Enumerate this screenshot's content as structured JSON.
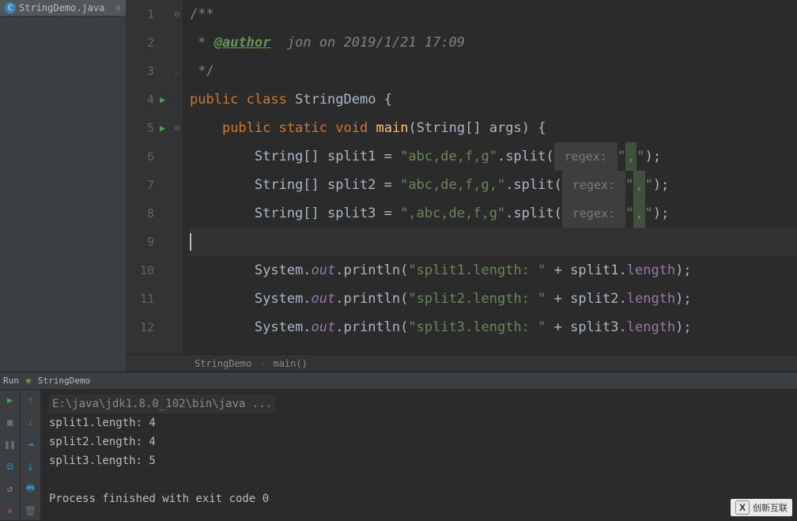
{
  "tab": {
    "filename": "StringDemo.java"
  },
  "gutter": {
    "lines": [
      "1",
      "2",
      "3",
      "4",
      "5",
      "6",
      "7",
      "8",
      "9",
      "10",
      "11",
      "12"
    ]
  },
  "code": {
    "l1_open": "/**",
    "l2_star": " *",
    "l2_tag": "@author",
    "l2_rest": "  jon on 2019/1/21 17:09",
    "l3_close": " */",
    "l4_public": "public",
    "l4_class": "class",
    "l4_name": "StringDemo",
    "l4_brace": " {",
    "l5_public": "public",
    "l5_static": "static",
    "l5_void": "void",
    "l5_main": "main",
    "l5_sig": "(String[] args) {",
    "l6_decl": "String[] split1 = ",
    "l6_str": "\"abc,de,f,g\"",
    "l6_call": ".split(",
    "hint": " regex: ",
    "l6_arg": "\",\"",
    "l6_end": ");",
    "l7_decl": "String[] split2 = ",
    "l7_str": "\"abc,de,f,g,\"",
    "l7_arg": "\",\"",
    "l8_decl": "String[] split3 = ",
    "l8_str": "\",abc,de,f,g\"",
    "l8_arg": "\",\"",
    "l10_sys": "System.",
    "l10_out": "out",
    "l10_print": ".println(",
    "l10_str": "\"split1.length: \"",
    "l10_plus": " + split1.",
    "l10_len": "length",
    "l10_end": ");",
    "l11_str": "\"split2.length: \"",
    "l11_plus": " + split2.",
    "l12_str": "\"split3.length: \"",
    "l12_plus": " + split3."
  },
  "breadcrumb": {
    "class": "StringDemo",
    "method": "main()"
  },
  "run": {
    "label": "Run",
    "config": "StringDemo",
    "cmd": "E:\\java\\jdk1.8.0_102\\bin\\java ...",
    "out1": "split1.length: 4",
    "out2": "split2.length: 4",
    "out3": "split3.length: 5",
    "exit": "Process finished with exit code 0"
  },
  "watermark": {
    "text": "创新互联"
  }
}
